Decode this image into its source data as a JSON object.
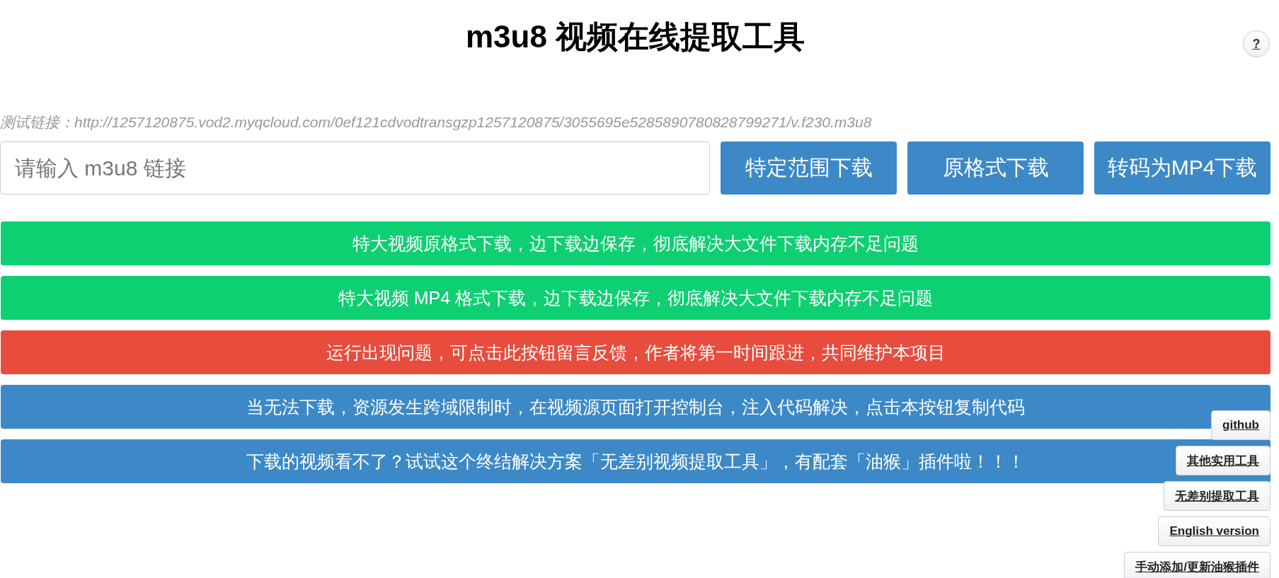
{
  "title": "m3u8 视频在线提取工具",
  "help_button": {
    "label": "?"
  },
  "test_link": "测试链接：http://1257120875.vod2.myqcloud.com/0ef121cdvodtransgzp1257120875/3055695e5285890780828799271/v.f230.m3u8",
  "url_input": {
    "placeholder": "请输入 m3u8 链接"
  },
  "action_buttons": [
    "特定范围下载",
    "原格式下载",
    "转码为MP4下载"
  ],
  "banners": [
    {
      "label": "特大视频原格式下载，边下载边保存，彻底解决大文件下载内存不足问题",
      "color": "#0fcf73"
    },
    {
      "label": "特大视频 MP4 格式下载，边下载边保存，彻底解决大文件下载内存不足问题",
      "color": "#0fcf73"
    },
    {
      "label": "运行出现问题，可点击此按钮留言反馈，作者将第一时间跟进，共同维护本项目",
      "color": "#e74c3c"
    },
    {
      "label": "当无法下载，资源发生跨域限制时，在视频源页面打开控制台，注入代码解决，点击本按钮复制代码",
      "color": "#3d89c7"
    },
    {
      "label": "下载的视频看不了？试试这个终结解决方案「无差别视频提取工具」，有配套「油猴」插件啦！！！",
      "color": "#3d89c7"
    }
  ],
  "side_buttons": [
    "github",
    "其他实用工具",
    "无差别提取工具",
    "English version",
    "手动添加/更新油猴插件"
  ]
}
